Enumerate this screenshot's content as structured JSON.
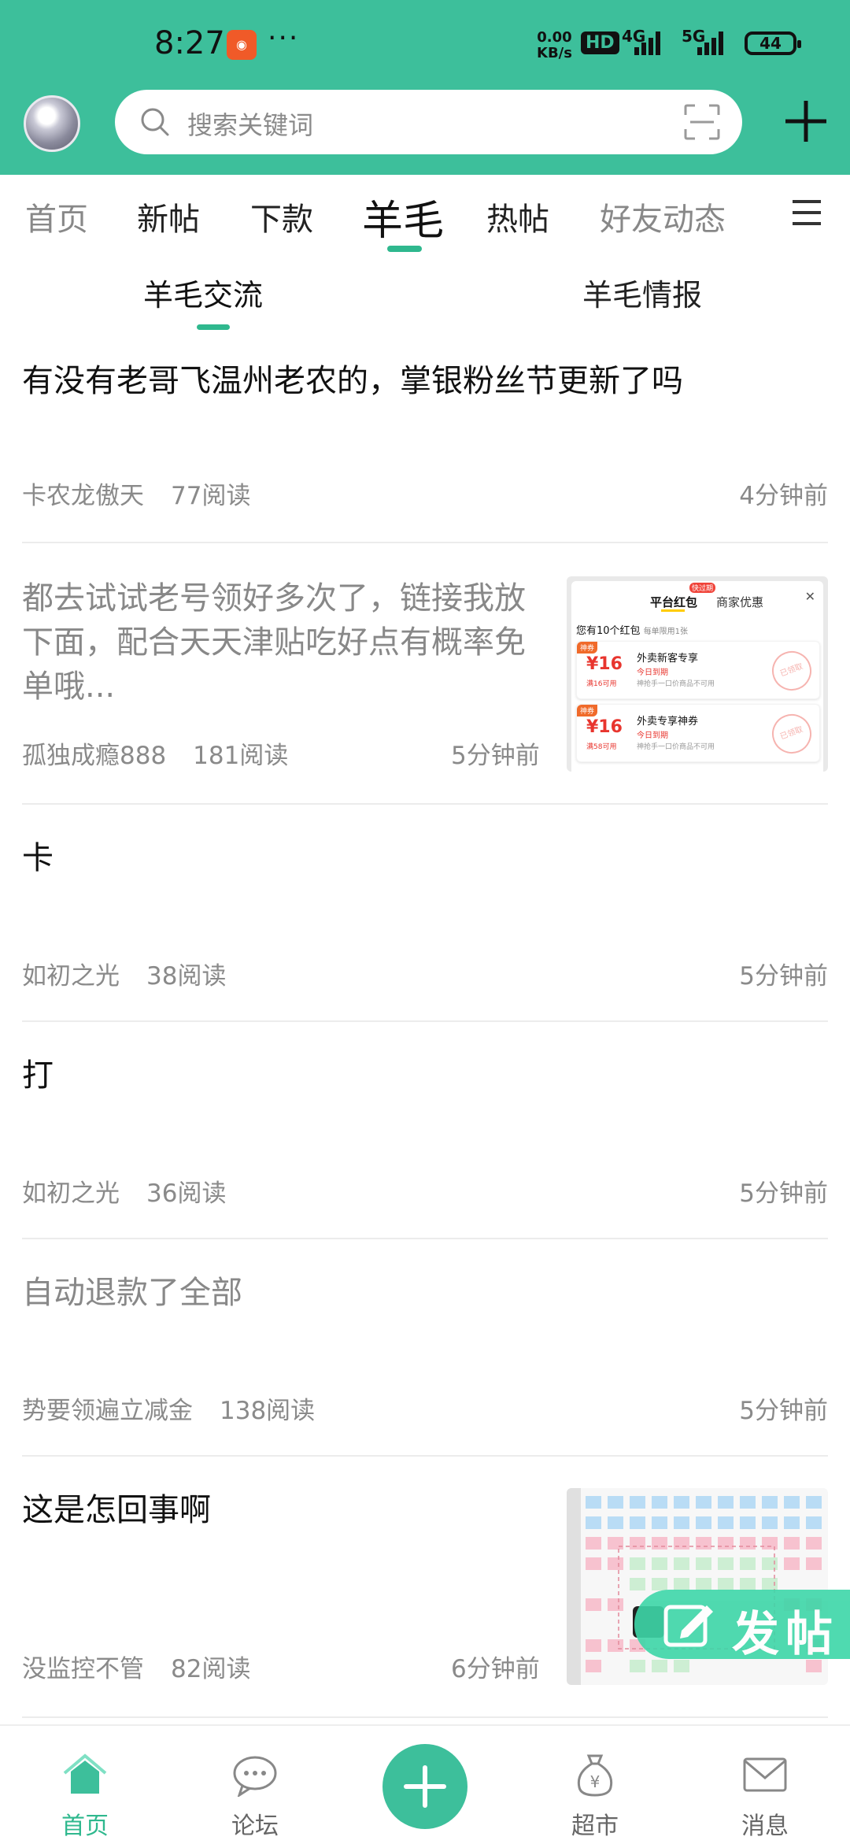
{
  "status": {
    "time": "8:27",
    "dots": "···",
    "speed_value": "0.00",
    "speed_unit": "KB/s",
    "hd": "HD",
    "net1": "4G",
    "net2": "5G",
    "battery": "44"
  },
  "search": {
    "placeholder": "搜索关键词"
  },
  "tabs": [
    {
      "label": "首页"
    },
    {
      "label": "新帖"
    },
    {
      "label": "下款"
    },
    {
      "label": "羊毛"
    },
    {
      "label": "热帖"
    },
    {
      "label": "好友动态"
    }
  ],
  "subtabs": [
    {
      "label": "羊毛交流"
    },
    {
      "label": "羊毛情报"
    }
  ],
  "posts": [
    {
      "title": "有没有老哥飞温州老农的，掌银粉丝节更新了吗",
      "author": "卡农龙傲天",
      "reads": "77阅读",
      "time": "4分钟前"
    },
    {
      "title": "都去试试老号领好多次了，链接我放下面，配合天天津贴吃好点有概率免单哦...",
      "author": "孤独成瘾888",
      "reads": "181阅读",
      "time": "5分钟前",
      "thumb": {
        "tab1": "平台红包",
        "tab2": "商家优惠",
        "badge": "快过期",
        "header": "您有10个红包",
        "header_sub": "每单限用1张",
        "coupons": [
          {
            "tag": "神券",
            "amount": "¥16",
            "cond": "满16可用",
            "name": "外卖新客专享",
            "expire": "今日到期",
            "note": "神抢手一口价商品不可用",
            "stamp": "已领取"
          },
          {
            "tag": "神券",
            "amount": "¥16",
            "cond": "满58可用",
            "name": "外卖专享神券",
            "expire": "今日到期",
            "note": "神抢手一口价商品不可用",
            "stamp": "已领取"
          }
        ]
      }
    },
    {
      "title": "卡",
      "author": "如初之光",
      "reads": "38阅读",
      "time": "5分钟前"
    },
    {
      "title": "打",
      "author": "如初之光",
      "reads": "36阅读",
      "time": "5分钟前"
    },
    {
      "title": "自动退款了全部",
      "author": "势要领遍立减金",
      "reads": "138阅读",
      "time": "5分钟前"
    },
    {
      "title": "这是怎回事啊",
      "author": "没监控不管",
      "reads": "82阅读",
      "time": "6分钟前"
    }
  ],
  "fab": {
    "label": "发帖"
  },
  "bottom_nav": [
    {
      "label": "首页"
    },
    {
      "label": "论坛"
    },
    {
      "label": "超市"
    },
    {
      "label": "消息"
    }
  ],
  "colors": {
    "brand": "#3dbf9b",
    "accent": "#2fb88e"
  }
}
